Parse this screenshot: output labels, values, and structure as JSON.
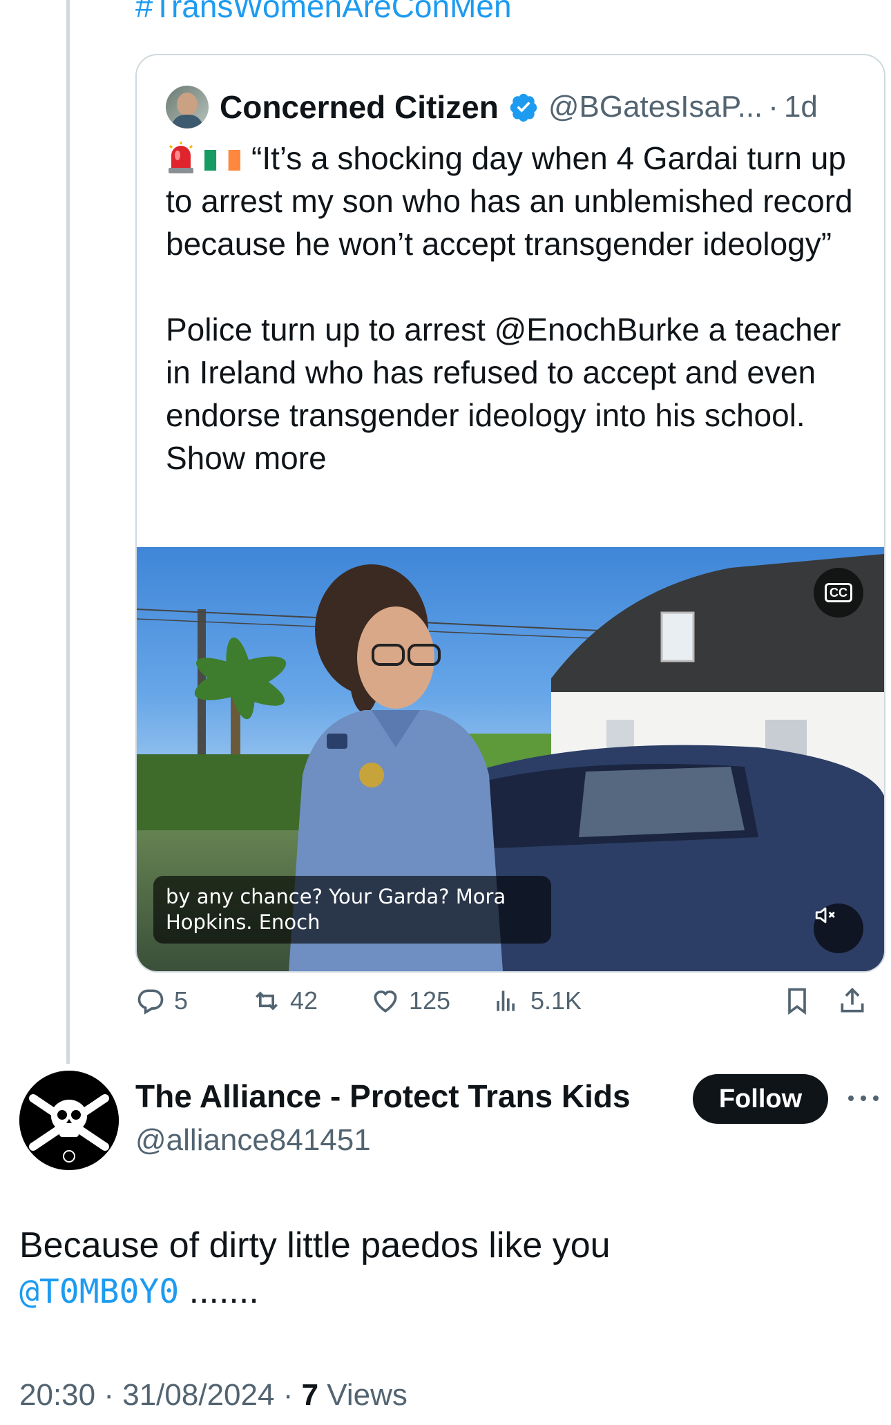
{
  "thread": {
    "hashtag_top": "#TransWomenAreConMen"
  },
  "quoted_post": {
    "author_name": "Concerned Citizen",
    "handle": "@BGatesIsaP...",
    "separator": "·",
    "time": "1d",
    "text_line1": "“It’s a shocking day when 4 Gardai turn up to arrest my son who has an unblemished record because he won’t accept transgender ideology”",
    "text_para2_prefix": "Police turn up to arrest ",
    "mention": "@EnochBurke",
    "text_para2_suffix": " a teacher in Ireland who has refused to accept and even endorse transgender ideology into his school. ",
    "show_more": "Show more",
    "video_caption": "by any chance? Your Garda? Mora Hopkins. Enoch",
    "cc_label": "CC",
    "icons": {
      "siren": "rotating-light-emoji",
      "flag": "ireland-flag-emoji",
      "verified": "verified-badge-icon"
    }
  },
  "actions": {
    "replies": "5",
    "reposts": "42",
    "likes": "125",
    "views": "5.1K"
  },
  "reply": {
    "author_name": "The Alliance - Protect Trans Kids",
    "handle": "@alliance841451",
    "follow_label": "Follow",
    "text_prefix": "Because of dirty little paedos like you",
    "mention": "@T0MB0Y0",
    "text_suffix": " .......",
    "time": "20:30",
    "date": "31/08/2024",
    "separator": "·",
    "views_count": "7",
    "views_label": "Views"
  },
  "colors": {
    "accent": "#1d9bf0",
    "text_primary": "#0f1419",
    "text_secondary": "#536471",
    "border": "#cfd9de"
  }
}
